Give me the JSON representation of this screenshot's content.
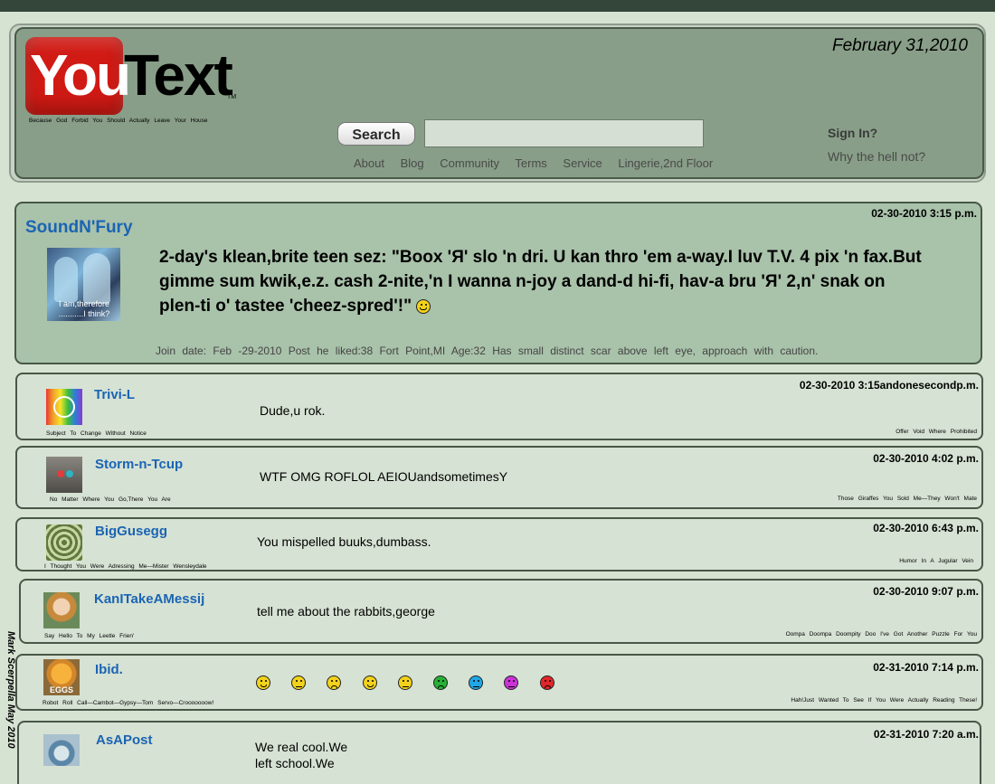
{
  "header": {
    "logo_you": "You",
    "logo_text": "Text",
    "logo_tm": "TM",
    "tagline": "Because God Forbid You Should Actually Leave Your House",
    "date": "February 31,2010",
    "search_label": "Search",
    "search_placeholder": "",
    "nav": [
      "About",
      "Blog",
      "Community",
      "Terms",
      "Service",
      "Lingerie,2nd Floor"
    ],
    "signin": "Sign In?",
    "whynot": "Why the hell not?"
  },
  "main_post": {
    "username": "SoundN'Fury",
    "date": "02-30-2010  3:15 p.m.",
    "avatar_caption": "I am,therefore ...........I think?",
    "body": "2-day's klean,brite teen sez: \"Boox 'Я' slo 'n dri. U kan thro 'em a-way.I luv T.V. 4 pix 'n fax.But gimme sum kwik,e.z. cash 2-nite,'n I wanna n-joy a dand-d hi-fi, hav-a bru 'Я' 2,n' snak on plen-ti o' tastee 'cheez-spred'!\"",
    "meta": "Join date: Feb -29-2010   Post he liked:38   Fort Point,MI Age:32 Has small distinct scar above left eye, approach with caution."
  },
  "replies": [
    {
      "username": "Trivi-L",
      "date": "02-30-2010 3:15andonesecondp.m.",
      "text": "Dude,u rok.",
      "signature": "Subject To Change Without Notice",
      "tagline": "Offer Void Where Prohibited"
    },
    {
      "username": "Storm-n-Tcup",
      "date": "02-30-2010 4:02 p.m.",
      "text": "WTF OMG ROFLOL  AEIOUandsometimesY",
      "signature": "No Matter Where You Go,There You Are",
      "tagline": "Those Giraffes You Sold Me—They Won't Mate"
    },
    {
      "username": "BigGusegg",
      "date": "02-30-2010 6:43 p.m.",
      "text": "You mispelled buuks,dumbass.",
      "signature": "I Thought You Were Adressing Me—Mister Wensleydale",
      "tagline": "Humor In A Jugular Vein"
    },
    {
      "username": "KanITakeAMessij",
      "date": "02-30-2010 9:07 p.m.",
      "text": "tell me about the rabbits,george",
      "signature": "Say Hello To My Leetle Frien'",
      "tagline": "Oompa Doompa Doompity Doo I've Got Another Puzzle For You"
    },
    {
      "username": "Ibid.",
      "date": "02-31-2010 7:14 p.m.",
      "text": "",
      "signature": "Robot Roll Call—Cambot—Gypsy—Tom Servo—Crooooooow!",
      "tagline": "Hah!Just Wanted To See If You Were Actually Reading These!",
      "avatar_caption": "EGGS"
    },
    {
      "username": "AsAPost",
      "date": "02-31-2010 7:20 a.m.",
      "text_line1": "We real cool.We",
      "text_line2": "left school.We"
    }
  ],
  "smileys": [
    {
      "color": "#f2d21c",
      "mood": "happy"
    },
    {
      "color": "#f2d21c",
      "mood": "neutral"
    },
    {
      "color": "#f2d21c",
      "mood": "sad"
    },
    {
      "color": "#f2d21c",
      "mood": "happy"
    },
    {
      "color": "#f2d21c",
      "mood": "neutral"
    },
    {
      "color": "#27b035",
      "mood": "sad"
    },
    {
      "color": "#1fa7e6",
      "mood": "neutral"
    },
    {
      "color": "#cc33d6",
      "mood": "neutral"
    },
    {
      "color": "#e0262b",
      "mood": "sad"
    }
  ],
  "side_signature": "Mark Scerpella May 2010",
  "colors": {
    "accent": "#1a64b4",
    "header_bg": "#889e88",
    "main_post_bg": "#a9c2aa",
    "reply_bg": "#d6e2d3",
    "logo_red": "#d11a14"
  }
}
